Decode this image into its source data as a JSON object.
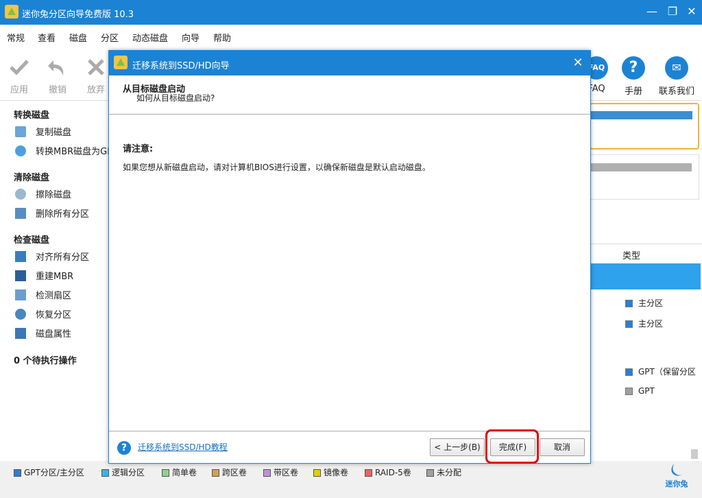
{
  "window": {
    "title": "迷你兔分区向导免费版 10.3"
  },
  "menu": [
    "常规",
    "查看",
    "磁盘",
    "分区",
    "动态磁盘",
    "向导",
    "帮助"
  ],
  "toolbar": {
    "apply": "应用",
    "undo": "撤销",
    "discard": "放弃",
    "faq": "FAQ",
    "manual": "手册",
    "contact": "联系我们"
  },
  "sidebar": {
    "sections": [
      {
        "title": "转换磁盘",
        "items": [
          "复制磁盘",
          "转换MBR磁盘为GPT"
        ]
      },
      {
        "title": "清除磁盘",
        "items": [
          "擦除磁盘",
          "删除所有分区"
        ]
      },
      {
        "title": "检查磁盘",
        "items": [
          "对齐所有分区",
          "重建MBR",
          "检测扇区",
          "恢复分区",
          "磁盘属性"
        ]
      }
    ],
    "pending": "0 个待执行操作"
  },
  "table": {
    "type_header": "类型",
    "rows": [
      "主分区",
      "主分区",
      "GPT（保留分区",
      "GPT"
    ]
  },
  "legend": [
    "GPT分区/主分区",
    "逻辑分区",
    "简单卷",
    "跨区卷",
    "带区卷",
    "镜像卷",
    "RAID-5卷",
    "未分配"
  ],
  "legend_colors": [
    "#2a7fd4",
    "#36b5e0",
    "#90d090",
    "#d4a050",
    "#c090e0",
    "#e0d000",
    "#f06060",
    "#a0a0a0"
  ],
  "brand": "迷你兔",
  "dialog": {
    "title": "迁移系统到SSD/HD向导",
    "step_title": "从目标磁盘启动",
    "step_subtitle": "如何从目标磁盘启动?",
    "notice_title": "请注意:",
    "notice_body": "如果您想从新磁盘启动，请对计算机BIOS进行设置，以确保新磁盘是默认启动磁盘。",
    "help_link": "迁移系统到SSD/HD教程",
    "back_button": "< 上一步(B)",
    "finish_button": "完成(F)",
    "cancel_button": "取消"
  }
}
